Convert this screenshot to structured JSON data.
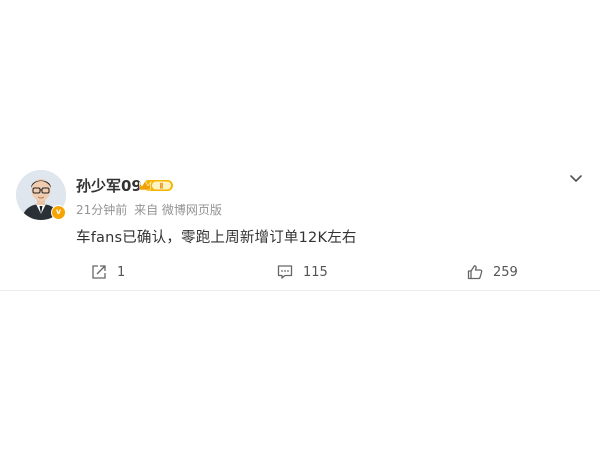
{
  "post": {
    "username": "孙少军09",
    "user_badge_text": "Ⅱ",
    "verified_badge": "v",
    "timestamp": "21分钟前",
    "source": "来自 微博网页版",
    "content": "车fans已确认，零跑上周新增订单12K左右",
    "actions": {
      "share_count": "1",
      "comment_count": "115",
      "like_count": "259"
    }
  },
  "icons": {
    "share": "share-icon",
    "comment": "comment-icon",
    "like": "thumbs-up-icon",
    "more": "chevron-down-icon"
  },
  "colors": {
    "badge_gold": "#f7a300",
    "meta_gray": "#939393",
    "text": "#333333"
  }
}
